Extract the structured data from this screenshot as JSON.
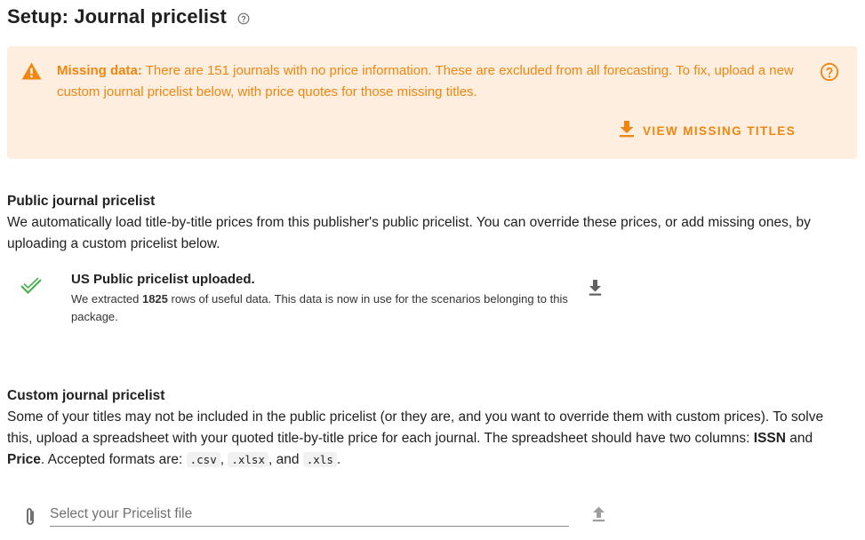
{
  "header": {
    "title": "Setup: Journal pricelist"
  },
  "alert": {
    "label": "Missing data:",
    "message": " There are 151 journals with no price information. These are excluded from all forecasting. To fix, upload a new custom journal pricelist below, with price quotes for those missing titles.",
    "action_label": "VIEW MISSING TITLES",
    "color": "#f0860f",
    "background": "#fdeee0"
  },
  "public": {
    "title": "Public journal pricelist",
    "description": "We automatically load title-by-title prices from this publisher's public pricelist. You can override these prices, or add missing ones, by uploading a custom pricelist below.",
    "status_title": "US Public pricelist uploaded.",
    "status_desc_pre": "We extracted ",
    "rows_count": "1825",
    "status_desc_post": " rows of useful data. This data is now in use for the scenarios belonging to this package.",
    "check_color": "#4caf50"
  },
  "custom": {
    "title": "Custom journal pricelist",
    "desc_1": "Some of your titles may not be included in the public pricelist (or they are, and you want to override them with custom prices). To solve this, upload a spreadsheet with your quoted title-by-title price for each journal. The spreadsheet should have two columns: ",
    "col_issn": "ISSN",
    "and_1": " and ",
    "col_price": "Price",
    "desc_2": ". Accepted formats are: ",
    "fmt_csv": ".csv",
    "sep_1": ", ",
    "fmt_xlsx": ".xlsx",
    "sep_2": ", and ",
    "fmt_xls": ".xls",
    "end": ".",
    "file_placeholder": "Select your Pricelist file"
  },
  "icons": {
    "title_help": "help-circle-icon",
    "warning": "warning-triangle-icon",
    "alert_help": "help-circle-icon",
    "download": "download-icon",
    "check": "check-icon",
    "paperclip": "paperclip-icon",
    "upload": "upload-icon"
  }
}
